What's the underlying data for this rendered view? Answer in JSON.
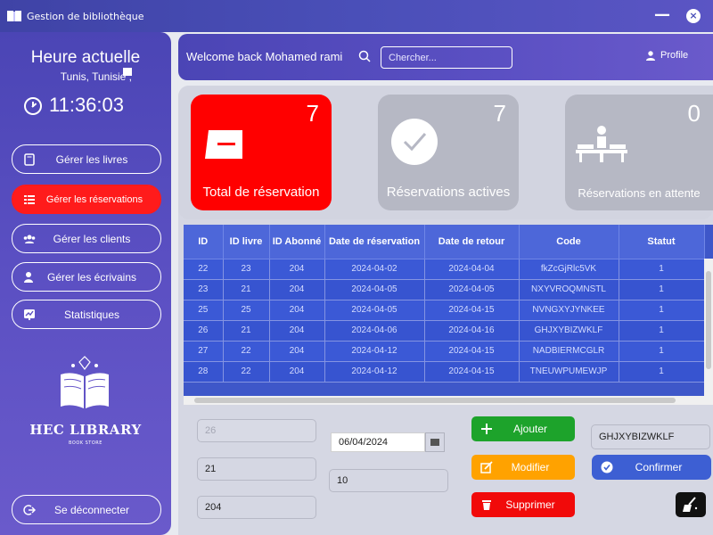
{
  "window": {
    "title": "Gestion de bibliothèque",
    "minimize": "—",
    "close": "×"
  },
  "sidebar": {
    "clock_title": "Heure actuelle",
    "location": "Tunis, Tunisie ,",
    "time": "11:36:03",
    "nav": [
      {
        "label": "Gérer les livres",
        "icon": "book-icon",
        "active": false
      },
      {
        "label": "Gérer les réservations",
        "icon": "list-icon",
        "active": true
      },
      {
        "label": "Gérer les clients",
        "icon": "users-icon",
        "active": false
      },
      {
        "label": "Gérer les écrivains",
        "icon": "writer-icon",
        "active": false
      },
      {
        "label": "Statistiques",
        "icon": "stats-icon",
        "active": false
      }
    ],
    "logo_title": "HEC LIBRARY",
    "logo_subtitle": "BOOK STORE",
    "logout": "Se déconnecter"
  },
  "header": {
    "welcome": "Welcome back Mohamed rami",
    "search_placeholder": "Chercher...",
    "profile": "Profile"
  },
  "stats": [
    {
      "label": "Total de réservation",
      "count": "7",
      "color": "#ff0000",
      "icon": "ticket-icon"
    },
    {
      "label": "Réservations actives",
      "count": "7",
      "color": "#b6b8c4",
      "icon": "check-icon"
    },
    {
      "label": "Réservations en attente",
      "count": "0",
      "color": "#b6b8c4",
      "icon": "waiting-room-icon"
    }
  ],
  "table": {
    "columns": [
      "ID",
      "ID livre",
      "ID Abonné",
      "Date de réservation",
      "Date de retour",
      "Code",
      "Statut"
    ],
    "rows": [
      [
        "22",
        "23",
        "204",
        "2024-04-02",
        "2024-04-04",
        "fkZcGjRlc5VK",
        "1"
      ],
      [
        "23",
        "21",
        "204",
        "2024-04-05",
        "2024-04-05",
        "NXYVROQMNSTL",
        "1"
      ],
      [
        "25",
        "25",
        "204",
        "2024-04-05",
        "2024-04-15",
        "NVNGXYJYNKEE",
        "1"
      ],
      [
        "26",
        "21",
        "204",
        "2024-04-06",
        "2024-04-16",
        "GHJXYBIZWKLF",
        "1"
      ],
      [
        "27",
        "22",
        "204",
        "2024-04-12",
        "2024-04-15",
        "NADBIERMCGLR",
        "1"
      ],
      [
        "28",
        "22",
        "204",
        "2024-04-12",
        "2024-04-15",
        "TNEUWPUMEWJP",
        "1"
      ]
    ]
  },
  "form": {
    "id_value": "26",
    "livre_value": "21",
    "abonne_value": "204",
    "date_value": "06/04/2024",
    "duration_value": "10",
    "code_value": "GHJXYBIZWKLF",
    "add": "Ajouter",
    "edit": "Modifier",
    "delete": "Supprimer",
    "confirm": "Confirmer"
  },
  "colors": {
    "accent": "#4b45b5",
    "active_nav": "#ff1b1b",
    "add": "#1da32b",
    "edit": "#ffa200",
    "delete": "#f10a0a",
    "confirm": "#3d5fd3"
  }
}
